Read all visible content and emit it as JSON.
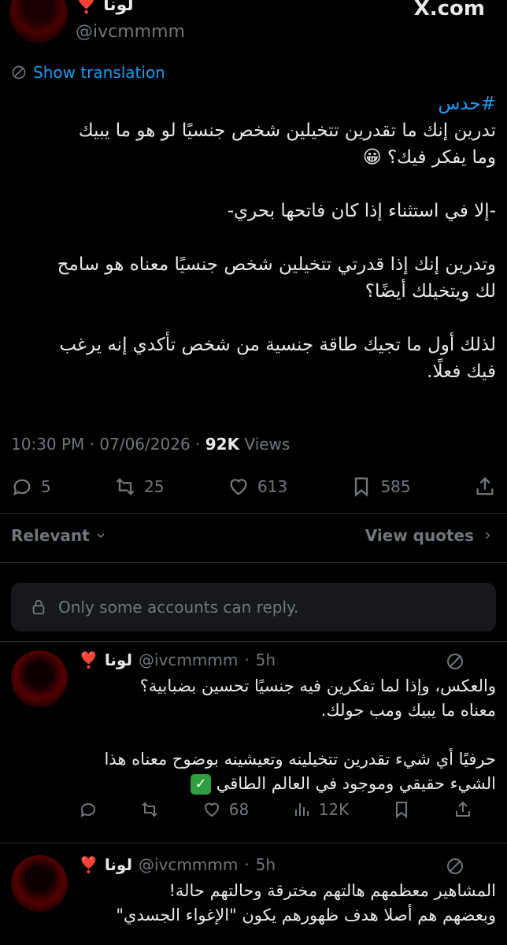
{
  "header": {
    "author_name": "لونا",
    "author_heart": "❣️",
    "handle": "@ivcmmmm",
    "site": "X.com"
  },
  "translate": {
    "label": "Show translation",
    "icon": "translate-globe-icon"
  },
  "tweet": {
    "hashtag": "#حدس",
    "lines": [
      "تدرين إنك ما تقدرين تتخيلين شخص جنسيًا لو هو ما يبيك",
      "وما يفكر فيك؟ 😀",
      "",
      "-إلا في استثناء إذا كان فاتحها بحري-",
      "",
      "وتدرين إنك إذا قدرتي تتخيلين شخص جنسيًا معناه هو سامح",
      "لك ويتخيلك أيضًا؟",
      "",
      "لذلك أول ما تجيك طاقة جنسية من شخص تأكدي إنه يرغب",
      "فيك فعلًا."
    ],
    "time": "10:30 PM",
    "date": "07/06/2026",
    "views_count": "92K",
    "views_label": "Views",
    "stats": {
      "replies": "5",
      "reposts": "25",
      "likes": "613",
      "bookmarks": "585"
    }
  },
  "sort": {
    "label": "Relevant",
    "view_quotes": "View quotes"
  },
  "reply_restriction": "Only some accounts can reply.",
  "replies": [
    {
      "name": "لونا",
      "heart": "❣️",
      "handle": "@ivcmmmm",
      "time": "5h",
      "lines": [
        "والعكس، وإذا لما تفكرين فيه جنسيًا تحسين بضبابية؟",
        "معناه ما يبيك ومب حولك.",
        "",
        "حرفيًا أي شيء تقدرين تتخيلينه وتعيشينه بوضوح معناه هذا",
        "الشيء حقيقي وموجود في العالم الطاقي"
      ],
      "stats": {
        "replies": "",
        "reposts": "",
        "likes": "68",
        "views": "12K"
      }
    },
    {
      "name": "لونا",
      "heart": "❣️",
      "handle": "@ivcmmmm",
      "time": "5h",
      "lines": [
        "المشاهير معظمهم هالتهم مخترقة وحالتهم حالة!",
        "وبعضهم هم أصلا هدف ظهورهم يكون \"الإغواء الجسدي\""
      ]
    }
  ],
  "colors": {
    "accent": "#1d9bf0",
    "background": "#000000",
    "muted": "#71767b",
    "text": "#e7e9ea"
  }
}
